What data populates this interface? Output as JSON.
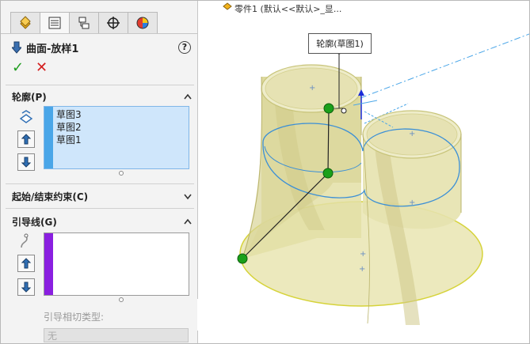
{
  "feature": {
    "title": "曲面-放样1",
    "help_label": "?",
    "ok_label": "✓",
    "cancel_label": "✕"
  },
  "tabs": [
    {
      "name": "feature-manager-icon"
    },
    {
      "name": "property-manager-icon"
    },
    {
      "name": "configuration-manager-icon"
    },
    {
      "name": "origin-crosshair-icon"
    },
    {
      "name": "appearance-ball-icon"
    }
  ],
  "profiles": {
    "header": "轮廓(P)",
    "chevron": "^",
    "items": [
      "草图3",
      "草图2",
      "草图1"
    ]
  },
  "constraints": {
    "header": "起始/结束约束(C)",
    "chevron": "v"
  },
  "guides": {
    "header": "引导线(G)",
    "chevron": "^",
    "tangency_label": "引导相切类型:",
    "tangency_value": "无"
  },
  "viewport": {
    "document_title": "零件1 (默认<<默认>_显...",
    "callout_text": "轮廓(草图1)"
  },
  "colors": {
    "accent_blue": "#4aa6e8",
    "guide_purple": "#8a1fe0",
    "surface": "#e9e6b0",
    "handle_green": "#1aa01a",
    "edge_blue": "#3b8fd6"
  }
}
